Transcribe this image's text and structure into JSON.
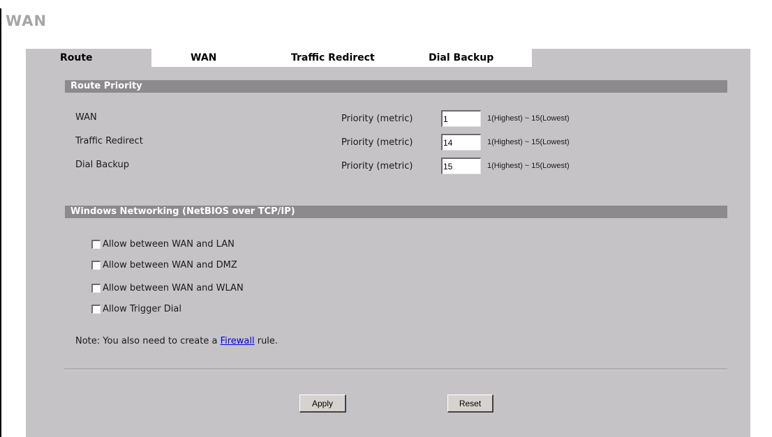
{
  "page": {
    "title": "WAN"
  },
  "tabs": [
    {
      "label": "Route",
      "active": true
    },
    {
      "label": "WAN",
      "active": false
    },
    {
      "label": "Traffic Redirect",
      "active": false
    },
    {
      "label": "Dial Backup",
      "active": false
    }
  ],
  "route_priority": {
    "heading": "Route Priority",
    "metric_label": "Priority (metric)",
    "hint": "1(Highest) ~ 15(Lowest)",
    "rows": [
      {
        "name": "WAN",
        "value": "1"
      },
      {
        "name": "Traffic Redirect",
        "value": "14"
      },
      {
        "name": "Dial Backup",
        "value": "15"
      }
    ]
  },
  "netbios": {
    "heading": "Windows Networking (NetBIOS over TCP/IP)",
    "options": [
      {
        "label": "Allow between WAN and LAN",
        "checked": false
      },
      {
        "label": "Allow between WAN and DMZ",
        "checked": false
      },
      {
        "label": "Allow between WAN and WLAN",
        "checked": false
      },
      {
        "label": "Allow Trigger Dial",
        "checked": false
      }
    ]
  },
  "note": {
    "prefix": "Note: You also need to create a ",
    "link": "Firewall",
    "suffix": " rule."
  },
  "buttons": {
    "apply": "Apply",
    "reset": "Reset"
  },
  "colors": {
    "panel": "#c6c3c6",
    "section_bar": "#8c8a8c",
    "title": "#a6a6a6",
    "link": "#0000ee"
  }
}
